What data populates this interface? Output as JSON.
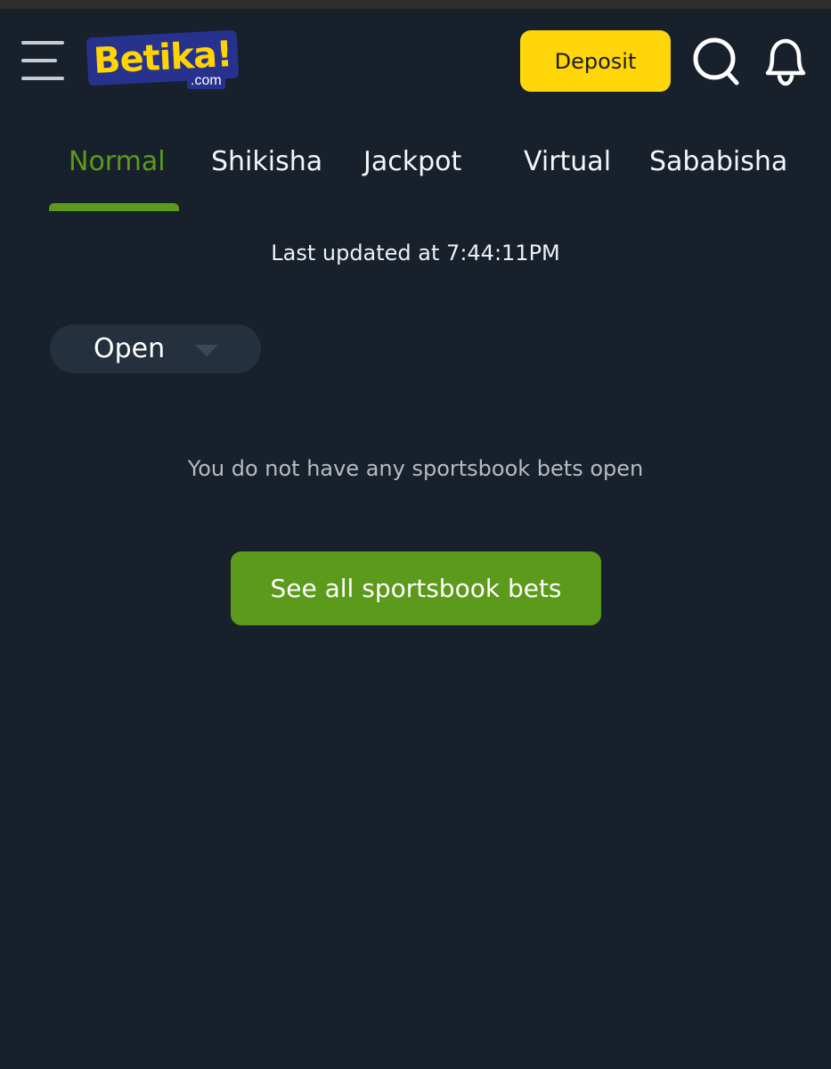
{
  "header": {
    "logo": {
      "brand": "Betika!",
      "domain": ".com"
    },
    "deposit_label": "Deposit",
    "icons": [
      "hamburger-menu-icon",
      "search-icon",
      "bell-icon"
    ]
  },
  "tabs": [
    {
      "label": "Normal",
      "active": true
    },
    {
      "label": "Shikisha",
      "active": false
    },
    {
      "label": "Jackpot",
      "active": false
    },
    {
      "label": "Virtual",
      "active": false
    },
    {
      "label": "Sababisha",
      "active": false
    }
  ],
  "status": {
    "last_updated": "Last updated at 7:44:11PM"
  },
  "filter": {
    "selected": "Open"
  },
  "empty_state": {
    "message": "You do not have any sportsbook bets open",
    "action_label": "See all sportsbook bets"
  },
  "colors": {
    "background": "#18202b",
    "accent_green": "#5c9a1b",
    "deposit_yellow": "#ffd60a",
    "logo_blue": "#27328e",
    "logo_yellow": "#ffd400"
  }
}
